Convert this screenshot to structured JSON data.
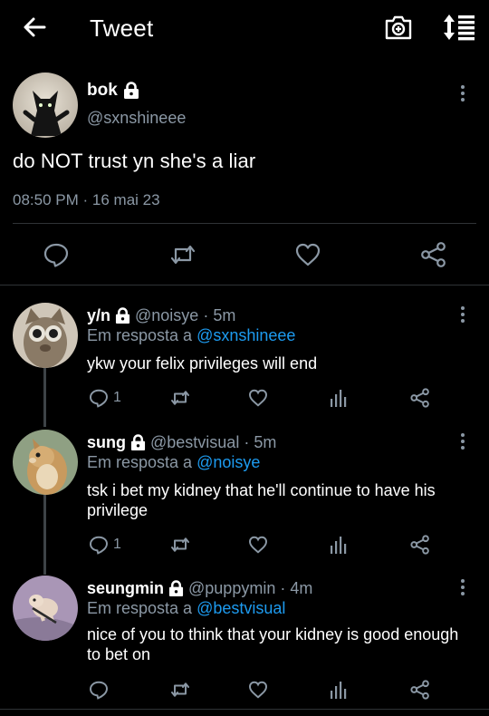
{
  "header": {
    "title": "Tweet",
    "back_icon": "arrow-left-icon",
    "camera_icon": "camera-plus-icon",
    "sort_icon": "sort-list-icon"
  },
  "main_tweet": {
    "name": "bok",
    "handle": "@sxnshineee",
    "text": "do NOT trust yn she's a liar",
    "time": "08:50 PM",
    "separator": "·",
    "date": "16 mai 23"
  },
  "replies": [
    {
      "name": "y/n",
      "handle": "@noisye",
      "dot": "·",
      "age": "5m",
      "replying_prefix": "Em resposta a",
      "replying_to": "@sxnshineee",
      "text": "ykw your felix privileges will end",
      "reply_count": "1"
    },
    {
      "name": "sung",
      "handle": "@bestvisual",
      "dot": "·",
      "age": "5m",
      "replying_prefix": "Em resposta a",
      "replying_to": "@noisye",
      "text": "tsk i bet my kidney that he'll continue to have his privilege",
      "reply_count": "1"
    },
    {
      "name": "seungmin",
      "handle": "@puppymin",
      "dot": "·",
      "age": "4m",
      "replying_prefix": "Em resposta a",
      "replying_to": "@bestvisual",
      "text": "nice of you to think that your kidney is good enough to bet on",
      "reply_count": ""
    }
  ],
  "colors": {
    "background": "#000000",
    "text": "#ffffff",
    "muted": "#8b98a5",
    "link": "#1d9bf0",
    "divider": "#2f3336"
  }
}
